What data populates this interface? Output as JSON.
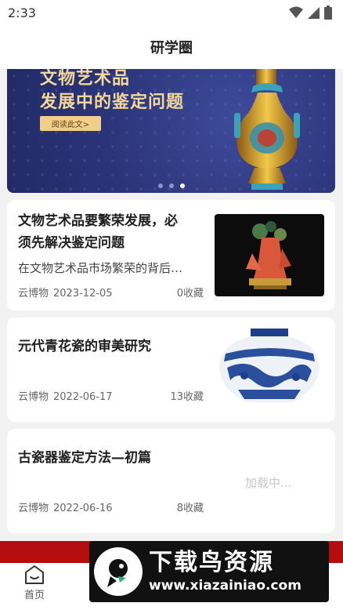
{
  "status_bar": {
    "time": "2:33"
  },
  "nav": {
    "title": "研学圈"
  },
  "banner": {
    "title_line1": "文物艺术品",
    "title_line2": "发展中的鉴定问题",
    "button_label": "阅读此文>",
    "dot_count": 3,
    "active_dot": 3
  },
  "articles": [
    {
      "title_line1": "文物艺术品要繁荣发展，必",
      "title_line2": "须先解决鉴定问题",
      "summary": "在文物艺术品市场繁荣的背后…",
      "source": "云博物",
      "date": "2023-12-05",
      "favorites": "0收藏",
      "image": "coral-sculpture-image"
    },
    {
      "title_line1": "元代青花瓷的审美研究",
      "source": "云博物",
      "date": "2022-06-17",
      "favorites": "13收藏",
      "image": "blue-white-porcelain-jar-image"
    },
    {
      "title_line1": "古瓷器鉴定方法—初篇",
      "source": "云博物",
      "date": "2022-06-16",
      "favorites": "8收藏",
      "image_loading_text": "加载中..."
    }
  ],
  "tabbar": {
    "items": [
      {
        "label": "首页",
        "icon": "home-icon"
      }
    ]
  },
  "watermark": {
    "title": "下载鸟资源",
    "url": "www.xiazainiao.com"
  },
  "colors": {
    "accent_red": "#b50d0d",
    "banner_blue": "#2b3478",
    "banner_gold": "#f3d89a"
  }
}
